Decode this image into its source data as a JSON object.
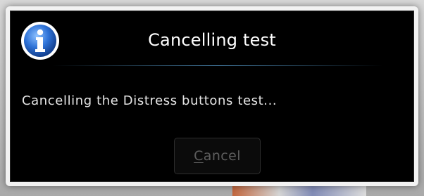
{
  "dialog": {
    "title": "Cancelling test",
    "message": "Cancelling the Distress buttons test...",
    "icon": "info-icon",
    "buttons": {
      "cancel_mnemonic": "C",
      "cancel_rest": "ancel",
      "cancel_state": "disabled"
    }
  },
  "colors": {
    "dialog_background": "#000000",
    "title_text": "#ffffff",
    "message_text": "#e6e6e6",
    "divider": "#4a86b0",
    "disabled_button_text": "#5d5d5d",
    "icon_blue": "#2f73d8"
  }
}
